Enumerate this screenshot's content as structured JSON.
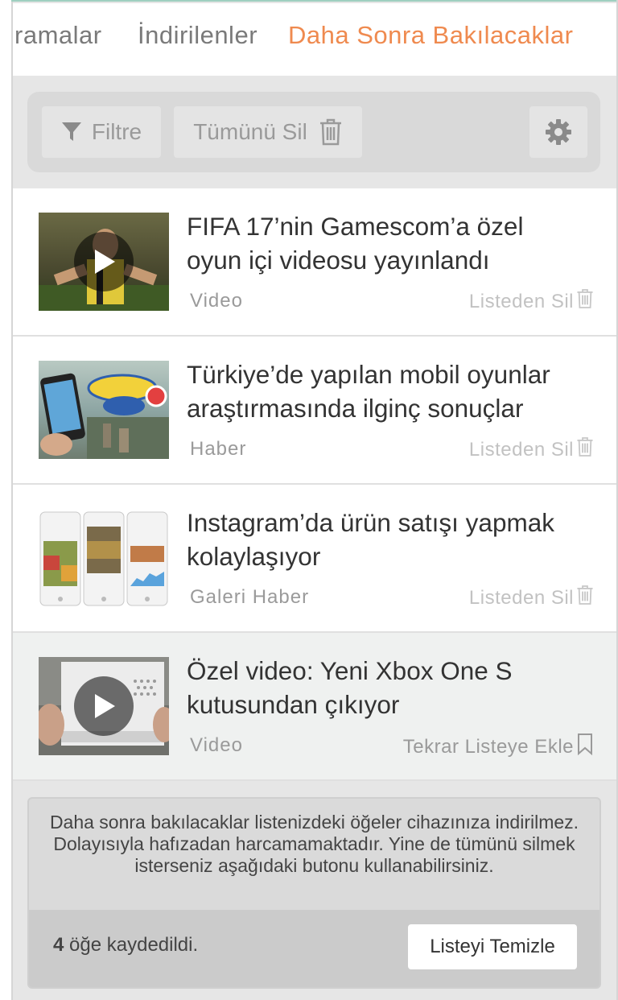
{
  "tabs": [
    {
      "label": "ramalar",
      "active": false
    },
    {
      "label": "İndirilenler",
      "active": false
    },
    {
      "label": "Daha Sonra Bakılacaklar",
      "active": true
    }
  ],
  "toolbar": {
    "filter_label": "Filtre",
    "delete_all_label": "Tümünü Sil",
    "settings_icon": "gear-icon"
  },
  "items": [
    {
      "title_line1": "FIFA 17’nin Gamescom’a özel",
      "title_line2": "oyun içi videosu yayınlandı",
      "category": "Video",
      "action": "Listeden Sil",
      "action_icon": "trash-icon",
      "has_play": true
    },
    {
      "title_line1": "Türkiye’de yapılan mobil oyunlar",
      "title_line2": "araştırmasında ilginç sonuçlar",
      "category": "Haber",
      "action": "Listeden Sil",
      "action_icon": "trash-icon",
      "has_play": false
    },
    {
      "title_line1": "Instagram’da ürün satışı yapmak",
      "title_line2": "kolaylaşıyor",
      "category": "Galeri Haber",
      "action": "Listeden Sil",
      "action_icon": "trash-icon",
      "has_play": false
    },
    {
      "title_line1": "Özel video: Yeni Xbox One S",
      "title_line2": "kutusundan çıkıyor",
      "category": "Video",
      "action": "Tekrar Listeye Ekle",
      "action_icon": "bookmark-icon",
      "has_play": true
    }
  ],
  "info": {
    "message": "Daha sonra bakılacaklar listenizdeki öğeler cihazınıza indirilmez. Dolayısıyla hafızadan harcamamaktadır. Yine de tümünü silmek isterseniz aşağıdaki butonu kullanabilirsiniz.",
    "saved_count": "4",
    "saved_suffix": "öğe kaydedildi.",
    "clear_button": "Listeyi Temizle"
  },
  "colors": {
    "accent": "#ef8a4f",
    "background": "#e6e6e6"
  }
}
